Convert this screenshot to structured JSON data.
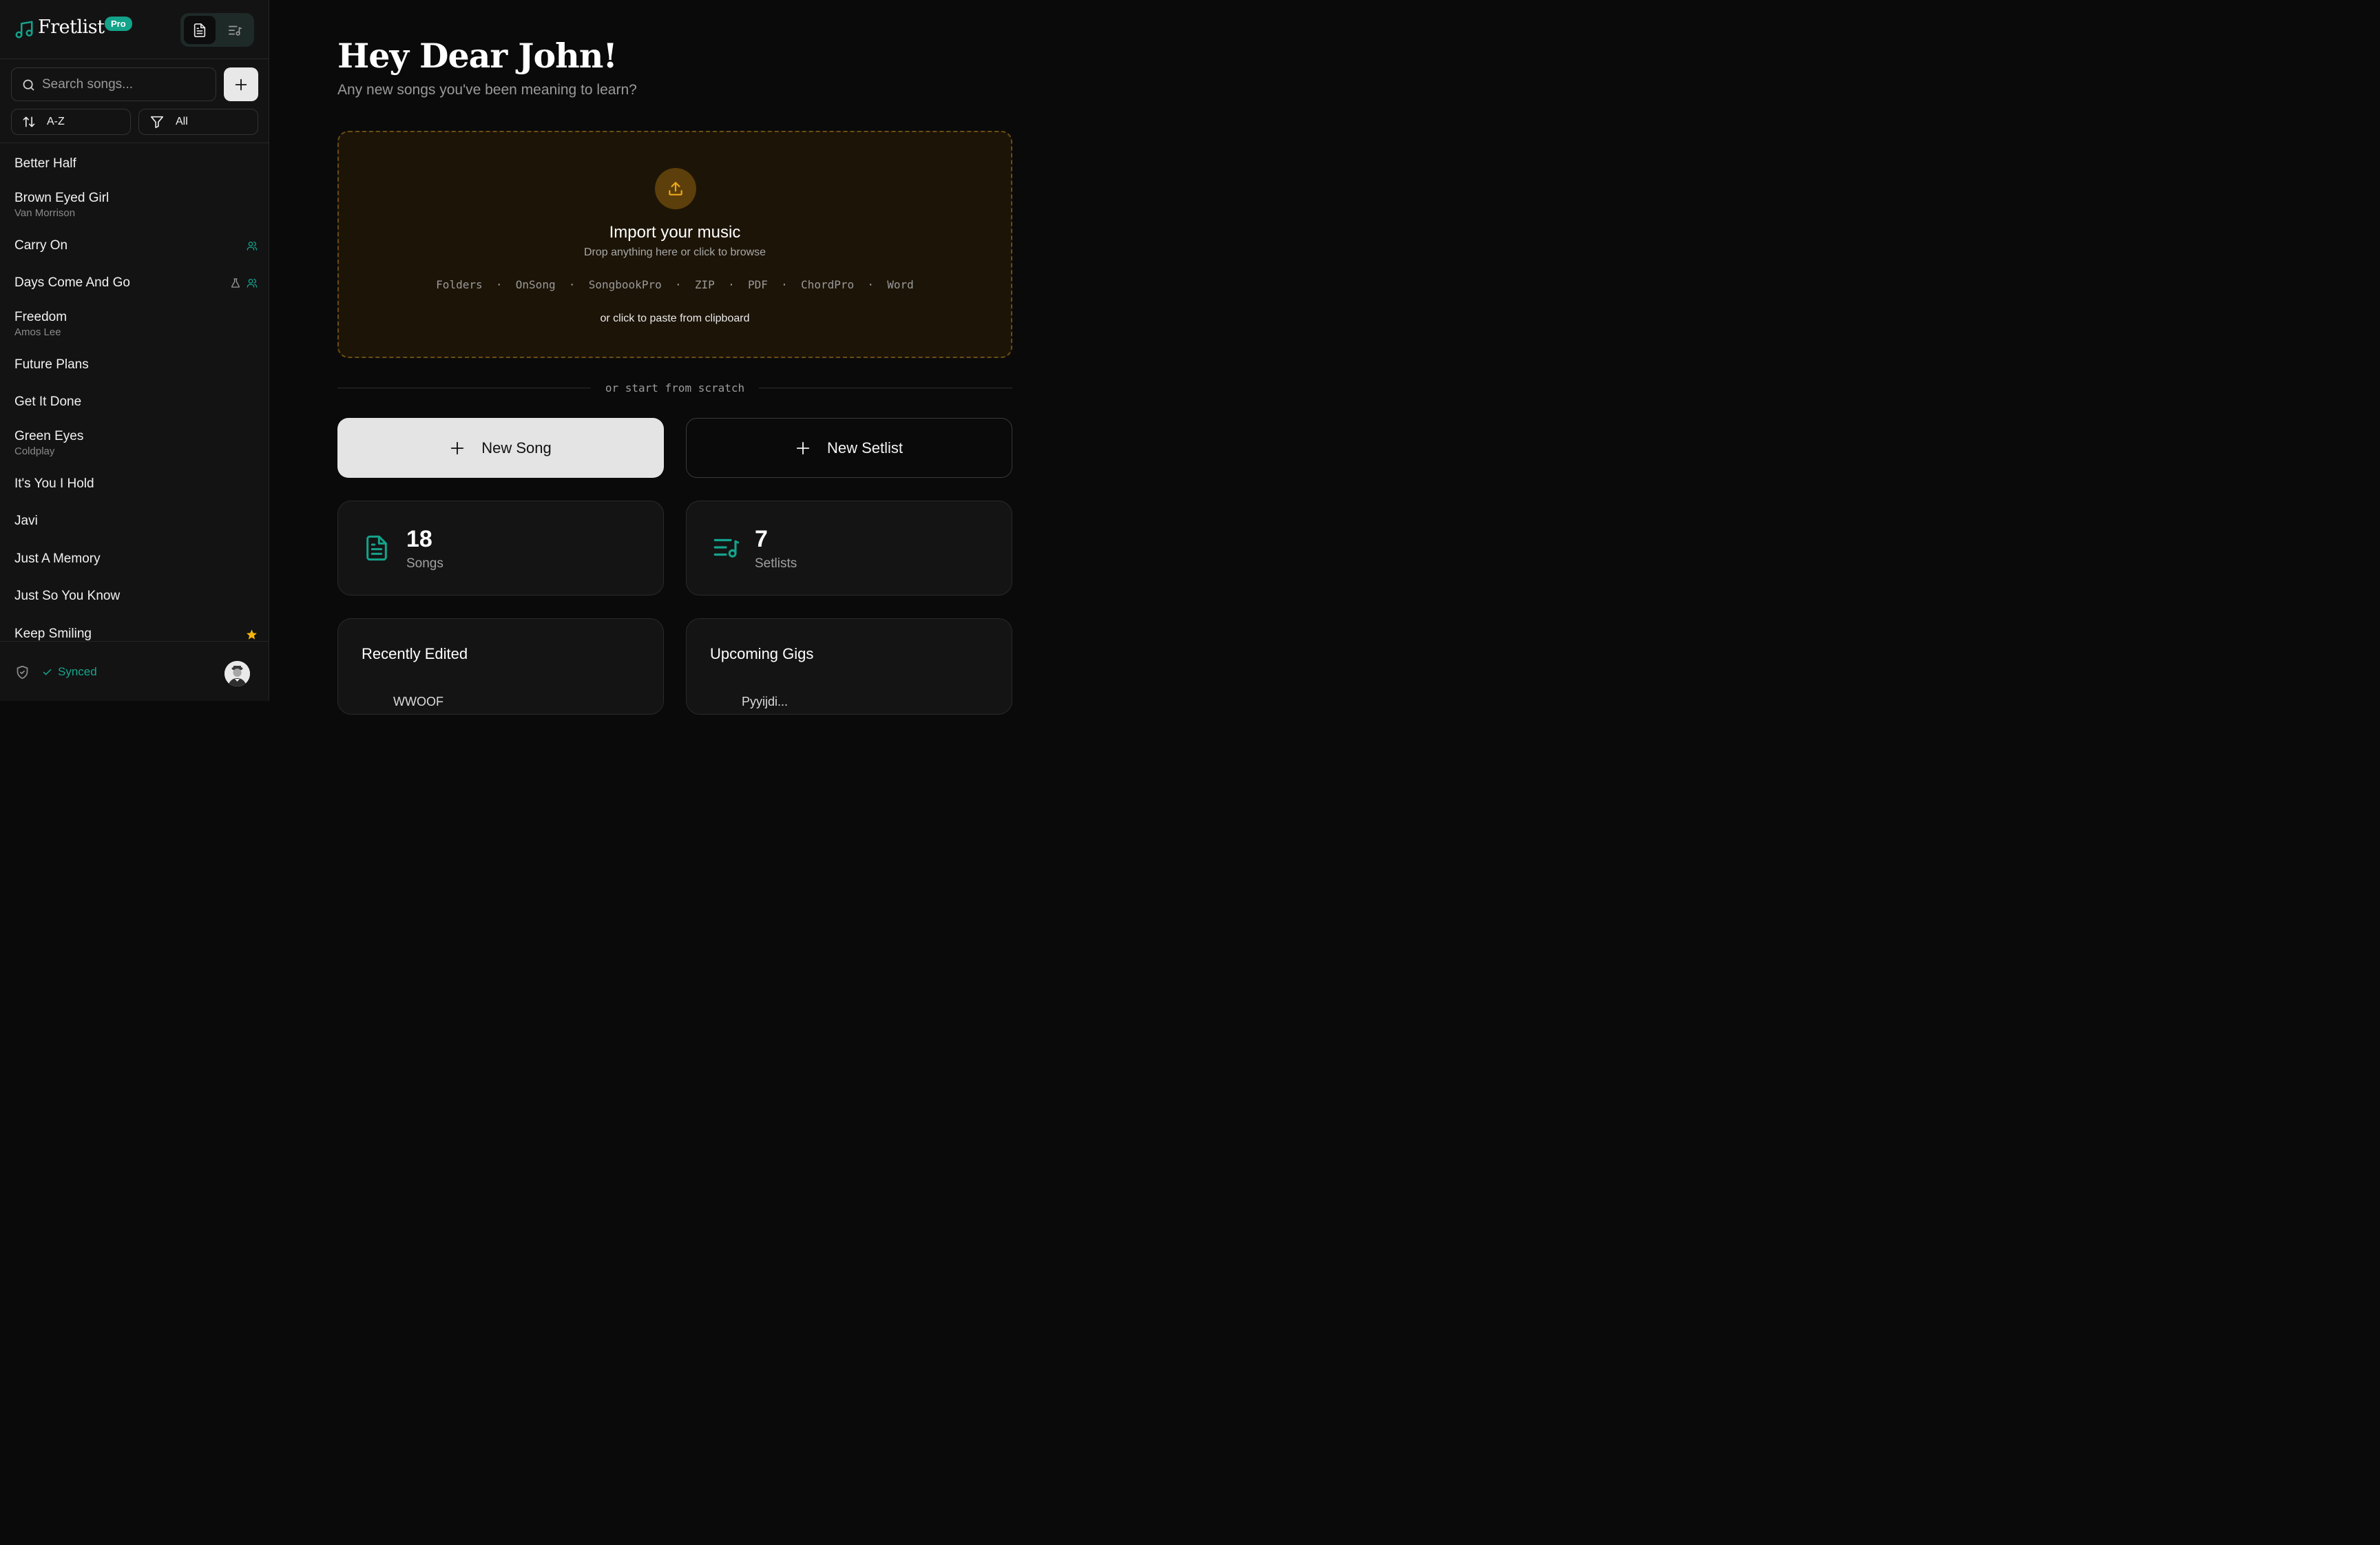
{
  "colors": {
    "accent": "#14a38b",
    "import_bg": "#1c1407",
    "import_border": "#6b4d12",
    "import_icon": "#f0a81a",
    "star": "#f5b50a"
  },
  "brand": {
    "name": "Fretlist",
    "badge": "Pro"
  },
  "sidebar": {
    "search_placeholder": "Search songs...",
    "sort_label": "A-Z",
    "filter_label": "All",
    "songs": [
      {
        "title": "Better Half",
        "artist": "",
        "icons": []
      },
      {
        "title": "Brown Eyed Girl",
        "artist": "Van Morrison",
        "icons": []
      },
      {
        "title": "Carry On",
        "artist": "",
        "icons": [
          "users-icon"
        ]
      },
      {
        "title": "Days Come And Go",
        "artist": "",
        "icons": [
          "flask-icon",
          "users-icon"
        ]
      },
      {
        "title": "Freedom",
        "artist": "Amos Lee",
        "icons": []
      },
      {
        "title": "Future Plans",
        "artist": "",
        "icons": []
      },
      {
        "title": "Get It Done",
        "artist": "",
        "icons": []
      },
      {
        "title": "Green Eyes",
        "artist": "Coldplay",
        "icons": []
      },
      {
        "title": "It's You I Hold",
        "artist": "",
        "icons": []
      },
      {
        "title": "Javi",
        "artist": "",
        "icons": []
      },
      {
        "title": "Just A Memory",
        "artist": "",
        "icons": []
      },
      {
        "title": "Just So You Know",
        "artist": "",
        "icons": []
      },
      {
        "title": "Keep Smiling",
        "artist": "",
        "icons": [
          "star-icon"
        ]
      }
    ],
    "sync_status": "Synced"
  },
  "main": {
    "greeting": "Hey Dear John!",
    "subgreeting": "Any new songs you've been meaning to learn?",
    "import": {
      "title": "Import your music",
      "subtitle": "Drop anything here or click to browse",
      "formats": [
        "Folders",
        "OnSong",
        "SongbookPro",
        "ZIP",
        "PDF",
        "ChordPro",
        "Word"
      ],
      "clipboard": "or click to paste from clipboard"
    },
    "divider": "or start from scratch",
    "new_song": "New Song",
    "new_setlist": "New Setlist",
    "stats": {
      "songs_count": "18",
      "songs_label": "Songs",
      "setlists_count": "7",
      "setlists_label": "Setlists"
    },
    "recently_edited": {
      "title": "Recently Edited",
      "first_item": "WWOOF"
    },
    "upcoming_gigs": {
      "title": "Upcoming Gigs",
      "first_item": "Pyyijdi..."
    }
  }
}
